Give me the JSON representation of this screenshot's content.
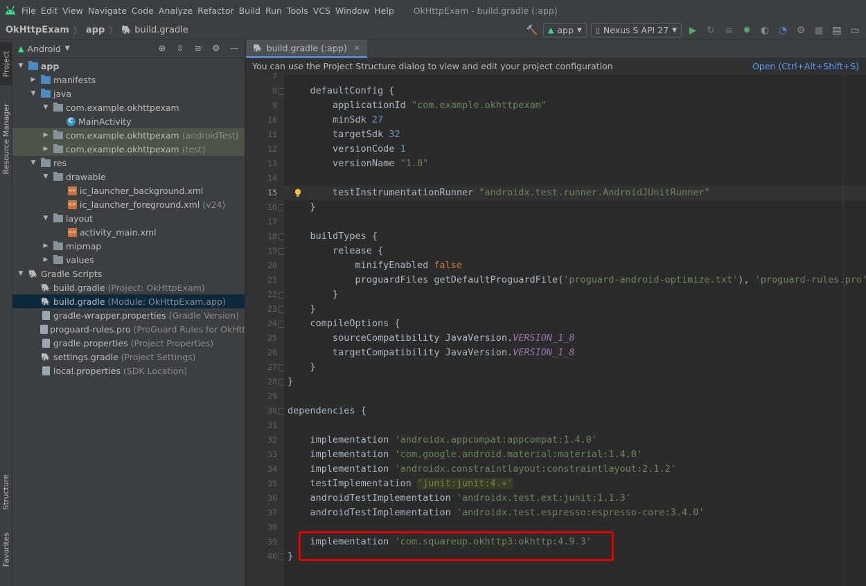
{
  "window": {
    "title": "OkHttpExam - build.gradle (:app)"
  },
  "menu": [
    "File",
    "Edit",
    "View",
    "Navigate",
    "Code",
    "Analyze",
    "Refactor",
    "Build",
    "Run",
    "Tools",
    "VCS",
    "Window",
    "Help"
  ],
  "breadcrumb": [
    "OkHttpExam",
    "app",
    "build.gradle"
  ],
  "toolbar": {
    "module": "app",
    "device": "Nexus S API 27"
  },
  "left_tabs": [
    "Project",
    "Resource Manager",
    "Structure",
    "Favorites"
  ],
  "project": {
    "view": "Android",
    "tree": [
      {
        "label": "app",
        "hint": ""
      },
      {
        "label": "manifests",
        "hint": ""
      },
      {
        "label": "java",
        "hint": ""
      },
      {
        "label": "com.example.okhttpexam",
        "hint": ""
      },
      {
        "label": "MainActivity",
        "hint": ""
      },
      {
        "label": "com.example.okhttpexam",
        "hint": "(androidTest)"
      },
      {
        "label": "com.example.okhttpexam",
        "hint": "(test)"
      },
      {
        "label": "res",
        "hint": ""
      },
      {
        "label": "drawable",
        "hint": ""
      },
      {
        "label": "ic_launcher_background.xml",
        "hint": ""
      },
      {
        "label": "ic_launcher_foreground.xml",
        "hint": "(v24)"
      },
      {
        "label": "layout",
        "hint": ""
      },
      {
        "label": "activity_main.xml",
        "hint": ""
      },
      {
        "label": "mipmap",
        "hint": ""
      },
      {
        "label": "values",
        "hint": ""
      },
      {
        "label": "Gradle Scripts",
        "hint": ""
      },
      {
        "label": "build.gradle",
        "hint": "(Project: OkHttpExam)"
      },
      {
        "label": "build.gradle",
        "hint": "(Module: OkHttpExam.app)"
      },
      {
        "label": "gradle-wrapper.properties",
        "hint": "(Gradle Version)"
      },
      {
        "label": "proguard-rules.pro",
        "hint": "(ProGuard Rules for OkHttpExam"
      },
      {
        "label": "gradle.properties",
        "hint": "(Project Properties)"
      },
      {
        "label": "settings.gradle",
        "hint": "(Project Settings)"
      },
      {
        "label": "local.properties",
        "hint": "(SDK Location)"
      }
    ]
  },
  "editor": {
    "tab": "build.gradle (:app)",
    "notice": "You can use the Project Structure dialog to view and edit your project configuration",
    "notice_action": "Open (Ctrl+Alt+Shift+S)",
    "current_line": 15,
    "lines": [
      {
        "n": "7",
        "segs": []
      },
      {
        "n": "8",
        "segs": [
          [
            "p",
            "    defaultConfig {"
          ]
        ]
      },
      {
        "n": "9",
        "segs": [
          [
            "p",
            "        applicationId "
          ],
          [
            "s",
            "\"com.example.okhttpexam\""
          ]
        ]
      },
      {
        "n": "10",
        "segs": [
          [
            "p",
            "        minSdk "
          ],
          [
            "n",
            "27"
          ]
        ]
      },
      {
        "n": "11",
        "segs": [
          [
            "p",
            "        targetSdk "
          ],
          [
            "n",
            "32"
          ]
        ]
      },
      {
        "n": "12",
        "segs": [
          [
            "p",
            "        versionCode "
          ],
          [
            "n",
            "1"
          ]
        ]
      },
      {
        "n": "13",
        "segs": [
          [
            "p",
            "        versionName "
          ],
          [
            "s",
            "\"1.0\""
          ]
        ]
      },
      {
        "n": "14",
        "segs": []
      },
      {
        "n": "15",
        "segs": [
          [
            "p",
            "        testInstrumentationRunner "
          ],
          [
            "s",
            "\"androidx.test.runner.AndroidJUnitRunner\""
          ]
        ]
      },
      {
        "n": "16",
        "segs": [
          [
            "p",
            "    }"
          ]
        ]
      },
      {
        "n": "17",
        "segs": []
      },
      {
        "n": "18",
        "segs": [
          [
            "p",
            "    buildTypes {"
          ]
        ]
      },
      {
        "n": "19",
        "segs": [
          [
            "p",
            "        release {"
          ]
        ]
      },
      {
        "n": "20",
        "segs": [
          [
            "p",
            "            minifyEnabled "
          ],
          [
            "k",
            "false"
          ]
        ]
      },
      {
        "n": "21",
        "segs": [
          [
            "p",
            "            proguardFiles getDefaultProguardFile("
          ],
          [
            "s",
            "'proguard-android-optimize.txt'"
          ],
          [
            "p",
            "), "
          ],
          [
            "s",
            "'proguard-rules.pro'"
          ]
        ]
      },
      {
        "n": "22",
        "segs": [
          [
            "p",
            "        }"
          ]
        ]
      },
      {
        "n": "23",
        "segs": [
          [
            "p",
            "    }"
          ]
        ]
      },
      {
        "n": "24",
        "segs": [
          [
            "p",
            "    compileOptions {"
          ]
        ]
      },
      {
        "n": "25",
        "segs": [
          [
            "p",
            "        sourceCompatibility JavaVersion."
          ],
          [
            "i",
            "VERSION_1_8"
          ]
        ]
      },
      {
        "n": "26",
        "segs": [
          [
            "p",
            "        targetCompatibility JavaVersion."
          ],
          [
            "i",
            "VERSION_1_8"
          ]
        ]
      },
      {
        "n": "27",
        "segs": [
          [
            "p",
            "    }"
          ]
        ]
      },
      {
        "n": "28",
        "segs": [
          [
            "p",
            "}"
          ]
        ]
      },
      {
        "n": "29",
        "segs": []
      },
      {
        "n": "30",
        "segs": [
          [
            "p",
            "dependencies {"
          ]
        ]
      },
      {
        "n": "31",
        "segs": []
      },
      {
        "n": "32",
        "segs": [
          [
            "p",
            "    implementation "
          ],
          [
            "s",
            "'androidx.appcompat:appcompat:1.4.0'"
          ]
        ]
      },
      {
        "n": "33",
        "segs": [
          [
            "p",
            "    implementation "
          ],
          [
            "s",
            "'com.google.android.material:material:1.4.0'"
          ]
        ]
      },
      {
        "n": "34",
        "segs": [
          [
            "p",
            "    implementation "
          ],
          [
            "s",
            "'androidx.constraintlayout:constraintlayout:2.1.2'"
          ]
        ]
      },
      {
        "n": "35",
        "segs": [
          [
            "p",
            "    testImplementation "
          ],
          [
            "h",
            "'junit:junit:4.+'"
          ]
        ]
      },
      {
        "n": "36",
        "segs": [
          [
            "p",
            "    androidTestImplementation "
          ],
          [
            "s",
            "'androidx.test.ext:junit:1.1.3'"
          ]
        ]
      },
      {
        "n": "37",
        "segs": [
          [
            "p",
            "    androidTestImplementation "
          ],
          [
            "s",
            "'androidx.test.espresso:espresso-core:3.4.0'"
          ]
        ]
      },
      {
        "n": "38",
        "segs": []
      },
      {
        "n": "39",
        "segs": [
          [
            "p",
            "    implementation "
          ],
          [
            "s",
            "'com.squareup.okhttp3:okhttp:4.9.3'"
          ]
        ]
      },
      {
        "n": "40",
        "segs": [
          [
            "p",
            "}"
          ]
        ]
      }
    ]
  },
  "colors": {
    "accent": "#4a88c7",
    "highlight_box": "#e60000",
    "string": "#6a8759",
    "number": "#6897bb",
    "keyword": "#cc7832"
  }
}
